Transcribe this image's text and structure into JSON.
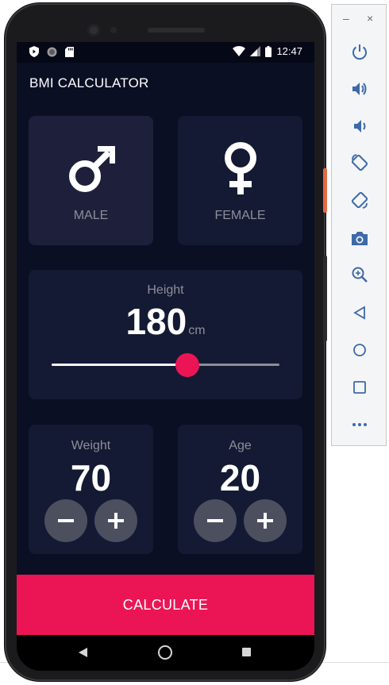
{
  "status_bar": {
    "time": "12:47"
  },
  "app": {
    "title": "BMI CALCULATOR"
  },
  "gender": {
    "male_label": "MALE",
    "female_label": "FEMALE",
    "selected": "MALE"
  },
  "height": {
    "label": "Height",
    "value": "180",
    "unit": "cm",
    "min": 120,
    "max": 220
  },
  "weight": {
    "label": "Weight",
    "value": "70"
  },
  "age": {
    "label": "Age",
    "value": "20"
  },
  "calculate_label": "CALCULATE",
  "colors": {
    "background": "#0b0f24",
    "card": "#141a33",
    "accent": "#eb1555",
    "round_button": "#4c4f5e",
    "muted_text": "#8d8e98"
  },
  "emulator_toolbar": {
    "minimize": "–",
    "close": "×",
    "items": [
      "power-icon",
      "volume-up-icon",
      "volume-down-icon",
      "rotate-left-icon",
      "rotate-right-icon",
      "camera-icon",
      "zoom-icon",
      "back-icon",
      "home-icon",
      "overview-icon",
      "more-icon"
    ]
  }
}
